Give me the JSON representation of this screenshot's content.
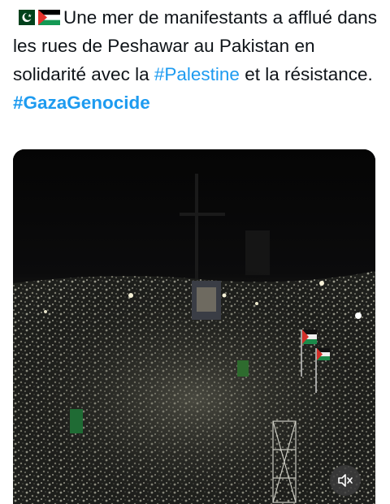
{
  "post": {
    "flags": [
      "pakistan-flag",
      "palestine-flag"
    ],
    "text_plain": "Une mer de manifestants a afflué dans les rues de Peshawar au Pakistan en solidarité avec la",
    "hashtag_1": "#Palestine",
    "text_after": " et la résistance.",
    "hashtag_2": "#GazaGenocide"
  },
  "media": {
    "type": "video",
    "icon": "mute-icon"
  }
}
